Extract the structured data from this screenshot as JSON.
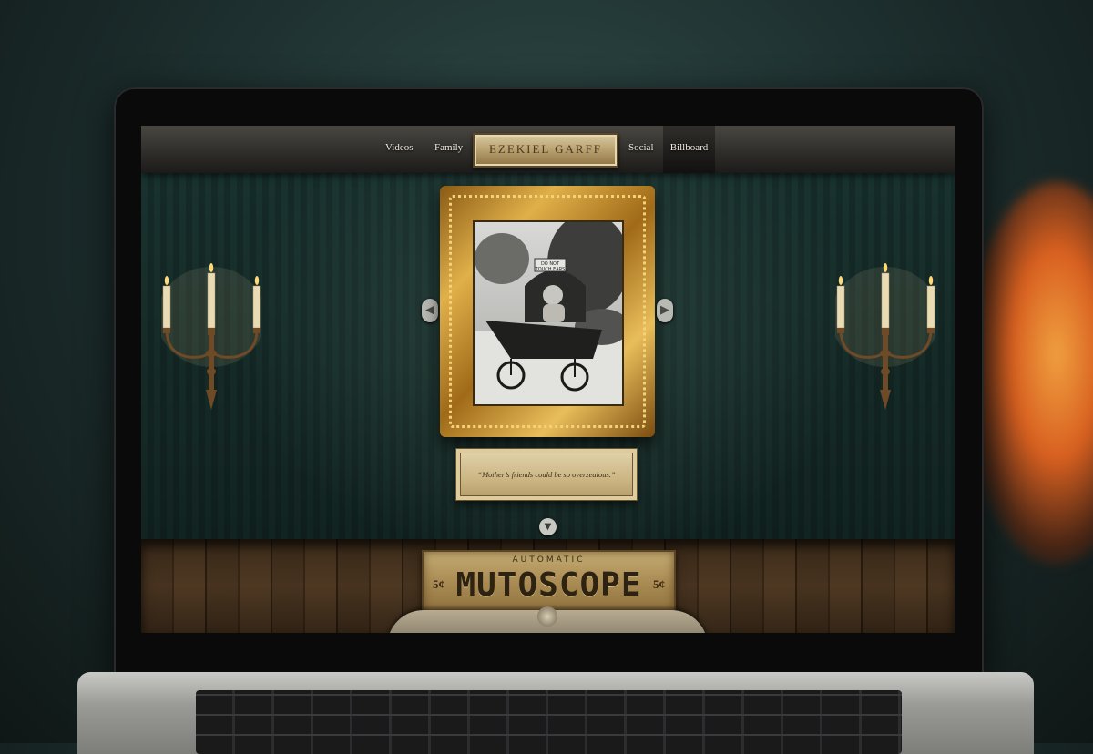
{
  "site": {
    "logo": "EZEKIEL GARFF",
    "nav": {
      "videos": "Videos",
      "family": "Family",
      "social": "Social",
      "billboard": "Billboard"
    }
  },
  "gallery": {
    "photo_sign_line1": "DO NOT",
    "photo_sign_line2": "TOUCH EARS",
    "caption": "“Mother’s friends could be so overzealous.”",
    "prev_icon": "chevron-left-icon",
    "next_icon": "chevron-right-icon",
    "scroll_icon": "chevron-down-icon"
  },
  "mutoscope": {
    "top": "AUTOMATIC",
    "title": "MUTOSCOPE",
    "price_left": "5¢",
    "price_right": "5¢"
  },
  "colors": {
    "wallpaper": "#1d3a36",
    "gold": "#e0b04a",
    "plaque": "#cbb582"
  }
}
